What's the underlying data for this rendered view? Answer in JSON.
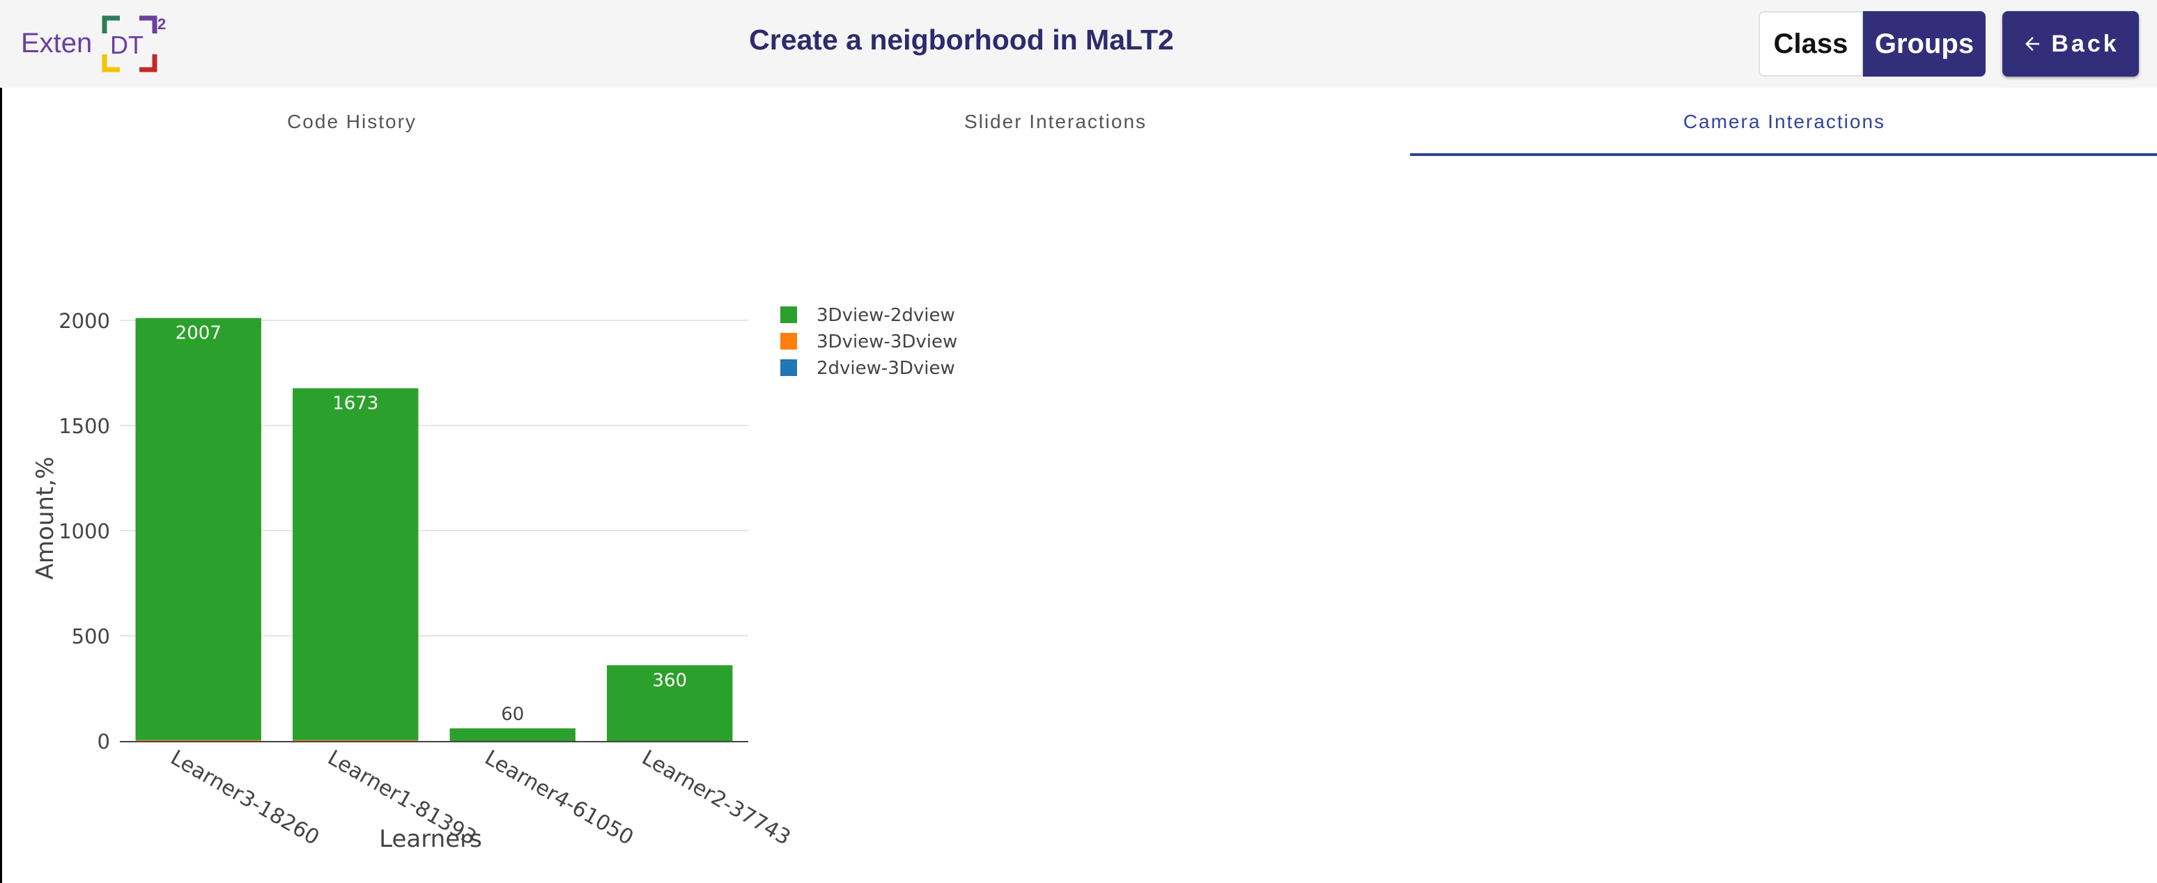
{
  "header": {
    "logo_text": "Exten",
    "logo_mark_text": "DT",
    "logo_superscript": "2",
    "title": "Create a neigborhood in MaLT2",
    "class_label": "Class",
    "groups_label": "Groups",
    "back_label": "Back",
    "accent_color": "#332e7a"
  },
  "tabs": [
    {
      "label": "Code History",
      "active": false
    },
    {
      "label": "Slider Interactions",
      "active": false
    },
    {
      "label": "Camera Interactions",
      "active": true
    }
  ],
  "chart_data": {
    "type": "bar",
    "mode": "stacked",
    "categories": [
      "Learner3-18260",
      "Learner1-81393",
      "Learner4-61050",
      "Learner2-37743"
    ],
    "series": [
      {
        "name": "3Dview-2dview",
        "color": "#2ca02c",
        "values": [
          2007,
          1673,
          60,
          360
        ]
      },
      {
        "name": "3Dview-3Dview",
        "color": "#ff7f0e",
        "values": [
          4,
          4,
          0,
          0
        ]
      },
      {
        "name": "2dview-3Dview",
        "color": "#1f77b4",
        "values": [
          0,
          0,
          0,
          0
        ]
      }
    ],
    "data_labels": [
      "2007",
      "1673",
      "60",
      "360"
    ],
    "xlabel": "Learners",
    "ylabel": "Amount,%",
    "ylim": [
      0,
      2000
    ],
    "yticks": [
      "0",
      "500",
      "1000",
      "1500",
      "2000"
    ],
    "grid": true,
    "legend_position": "right"
  }
}
